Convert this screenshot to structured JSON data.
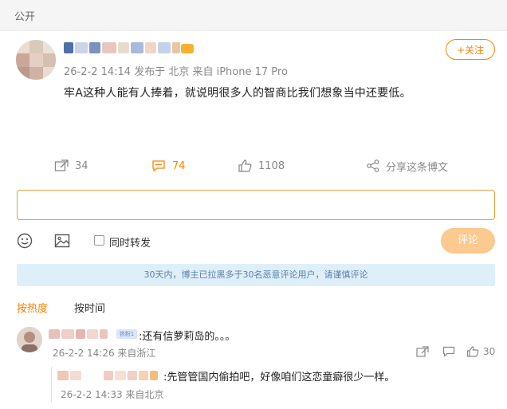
{
  "visibility": "公开",
  "post": {
    "meta": "26-2-2 14:14 发布于 北京  来自 iPhone 17 Pro",
    "follow_label": "+关注",
    "text": "牢A这种人能有人捧着，就说明很多人的智商比我们想象当中还要低。",
    "repost_count": "34",
    "comment_count": "74",
    "like_count": "1108",
    "share_label": "分享这条博文"
  },
  "composer": {
    "placeholder": "",
    "repost_label": "同时转发",
    "submit_label": "评论"
  },
  "notice": "30天内，博主已拉黑多于30名恶意评论用户，请谨慎评论",
  "sort": {
    "hot": "按热度",
    "time": "按时间"
  },
  "comments": [
    {
      "badge": "铁粉1",
      "text": ":还有信萝莉岛的。。。",
      "meta": "26-2-2 14:26 来自浙江",
      "likes": "30",
      "reply": {
        "text": ":先管管国内偷拍吧，好像咱们这恋童癖很少一样。",
        "meta": "26-2-2 14:33 来自北京"
      }
    }
  ],
  "colors": {
    "accent": "#ff8200",
    "notice_bg": "#dfeffa",
    "border_focus": "#e6a03c"
  },
  "icons": [
    "repost-icon",
    "comment-icon",
    "like-icon",
    "share-icon",
    "emoji-icon",
    "image-icon"
  ]
}
